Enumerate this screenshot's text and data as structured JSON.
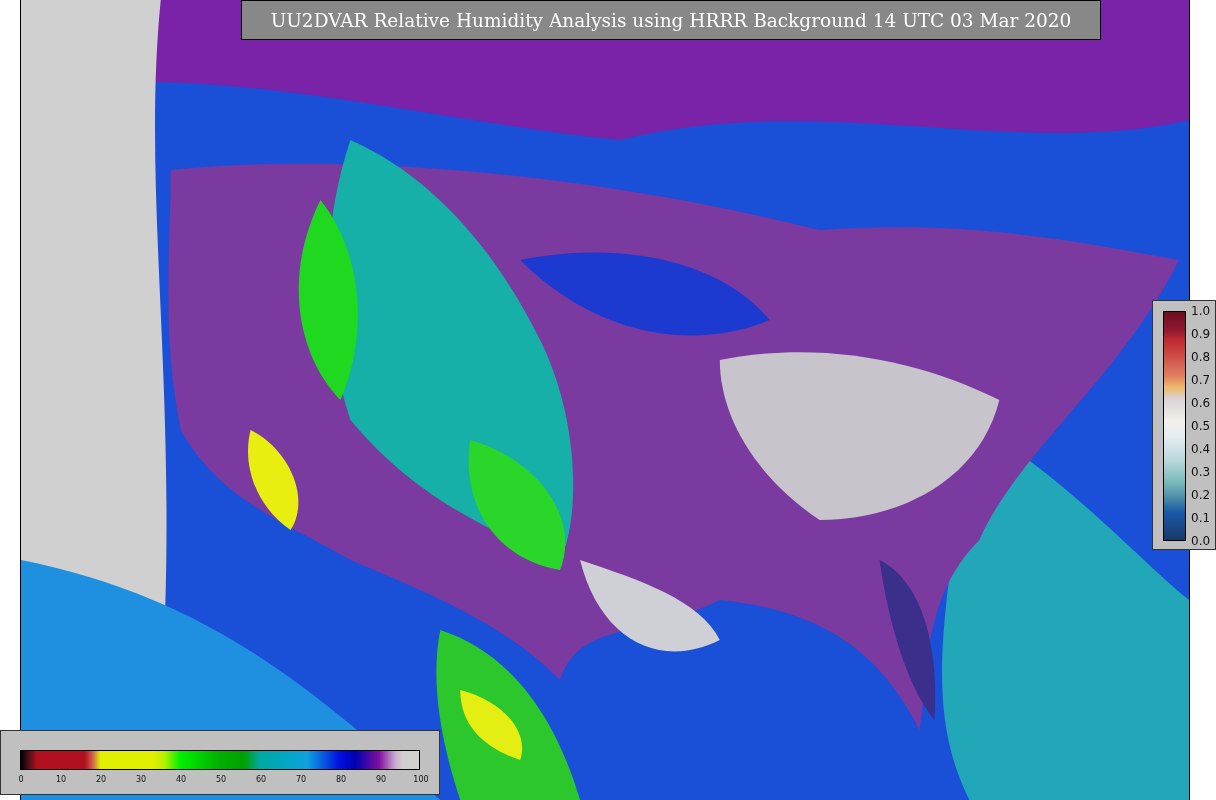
{
  "title": "UU2DVAR Relative Humidity Analysis using HRRR Background 14 UTC 03 Mar 2020",
  "bottom_colorbar": {
    "tick_labels": [
      "0",
      "10",
      "20",
      "30",
      "40",
      "50",
      "60",
      "70",
      "80",
      "90",
      "100"
    ]
  },
  "right_colorbar": {
    "tick_labels": [
      "1.0",
      "0.9",
      "0.8",
      "0.7",
      "0.6",
      "0.5",
      "0.4",
      "0.3",
      "0.2",
      "0.1",
      "0.0"
    ]
  }
}
